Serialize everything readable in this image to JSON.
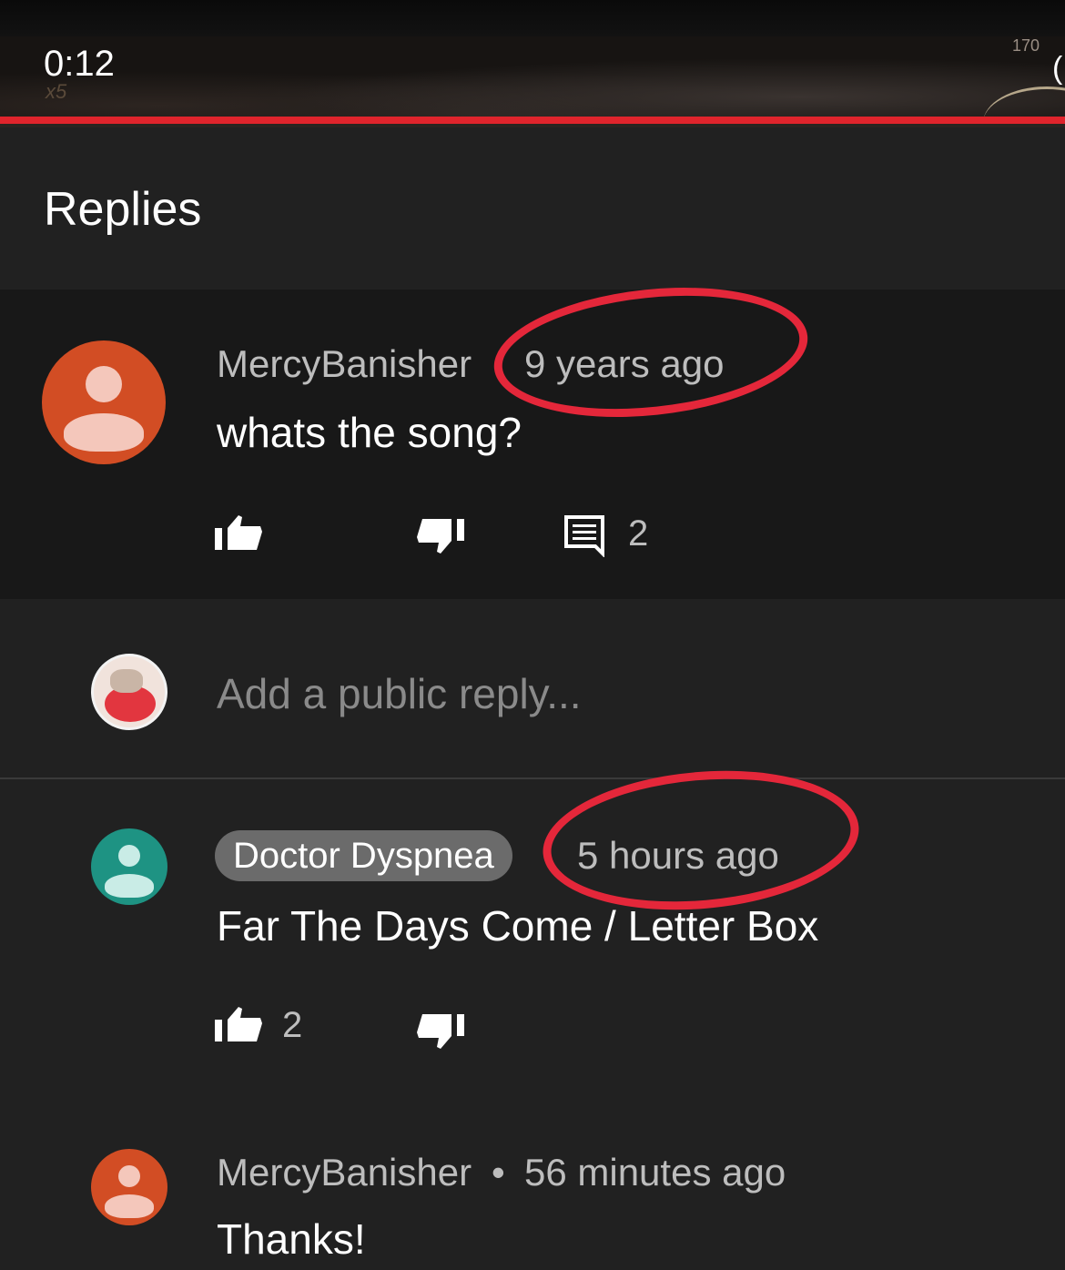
{
  "player": {
    "time": "0:12",
    "multiplier": "x5",
    "speed_readout": "170",
    "paren": "(",
    "progress_color": "#e0242c"
  },
  "panel": {
    "title": "Replies"
  },
  "top_comment": {
    "author": "MercyBanisher",
    "time": "9 years ago",
    "text": "whats the song?",
    "reply_count": "2",
    "avatar_color": "#d24d24"
  },
  "reply_box": {
    "placeholder": "Add a public reply..."
  },
  "replies": [
    {
      "author": "Doctor Dyspnea",
      "time": "5 hours ago",
      "text": "Far The Days Come / Letter Box",
      "like_count": "2",
      "avatar_color": "#1e9383"
    },
    {
      "author": "MercyBanisher",
      "separator": "•",
      "time": "56 minutes ago",
      "text": "Thanks!",
      "avatar_color": "#d24d24"
    }
  ],
  "icons": [
    "thumbs-up-icon",
    "thumbs-down-icon",
    "comment-icon"
  ],
  "annotation_color": "#e4273a"
}
